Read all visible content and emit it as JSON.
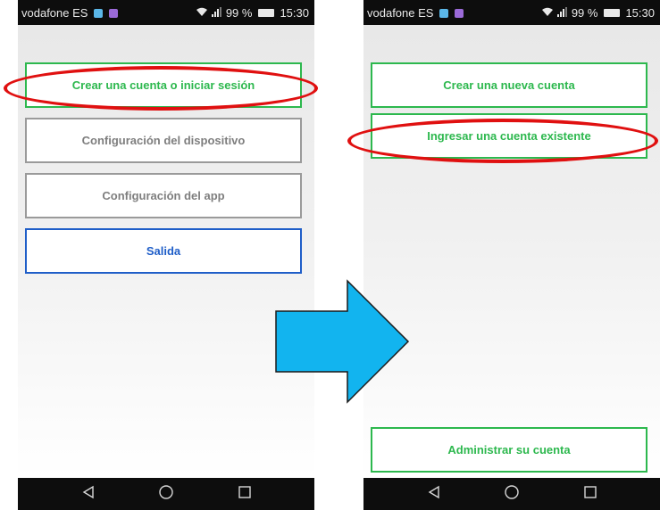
{
  "status_bar": {
    "carrier": "vodafone ES",
    "signal_text": " .ıl",
    "battery_percent": "99 %",
    "time": "15:30"
  },
  "left_screen": {
    "buttons": [
      {
        "label": "Crear una cuenta o iniciar sesión",
        "color": "#2db84e",
        "highlighted": true
      },
      {
        "label": "Configuración del dispositivo",
        "color": "#7e7e7e",
        "highlighted": false
      },
      {
        "label": "Configuración del app",
        "color": "#7e7e7e",
        "highlighted": false
      },
      {
        "label": "Salida",
        "color": "#1f5ec8",
        "highlighted": false
      }
    ]
  },
  "right_screen": {
    "buttons": [
      {
        "label": "Crear una nueva cuenta",
        "color": "#2db84e",
        "highlighted": false
      },
      {
        "label": "Ingresar una cuenta existente",
        "color": "#2db84e",
        "highlighted": true
      }
    ],
    "bottom_button": {
      "label": "Administrar su cuenta",
      "color": "#2db84e"
    }
  },
  "navigation_icons": [
    "back-icon",
    "home-icon",
    "recents-icon"
  ],
  "colors": {
    "highlight": "#e01010",
    "arrow_fill": "#12b4ef",
    "accent_green": "#2db84e",
    "accent_blue": "#1f5ec8"
  }
}
